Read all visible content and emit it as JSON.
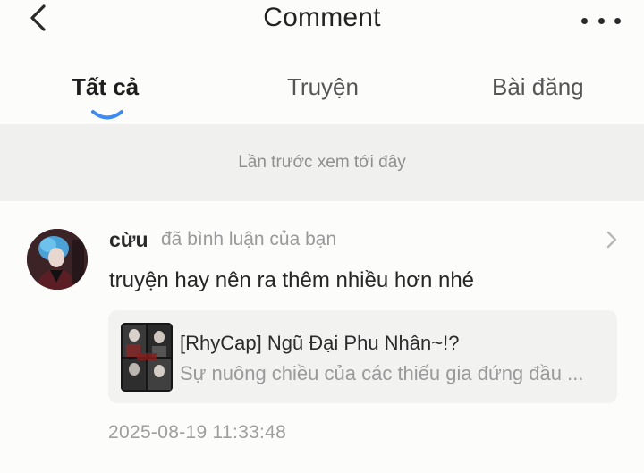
{
  "header": {
    "back_icon": "chevron-left-icon",
    "title": "Comment",
    "more_icon": "more-horizontal-icon"
  },
  "tabs": [
    {
      "label": "Tất cả",
      "active": true
    },
    {
      "label": "Truyện",
      "active": false
    },
    {
      "label": "Bài đăng",
      "active": false
    }
  ],
  "banner": {
    "text": "Lần trước xem tới đây"
  },
  "comment": {
    "username": "cừu",
    "action": "đã bình luận của bạn",
    "body": "truyện hay nên ra thêm nhiều hơn nhé",
    "timestamp": "2025-08-19 11:33:48",
    "story": {
      "title": "[RhyCap] Ngũ Đại Phu Nhân~!?",
      "description": "Sự nuông chiều của các thiếu gia đứng đầu ..."
    }
  },
  "colors": {
    "background": "#fcfcfb",
    "banner_bg": "#f0f0ef",
    "accent": "#3d8bf2",
    "card_bg": "#f2f2f1"
  }
}
